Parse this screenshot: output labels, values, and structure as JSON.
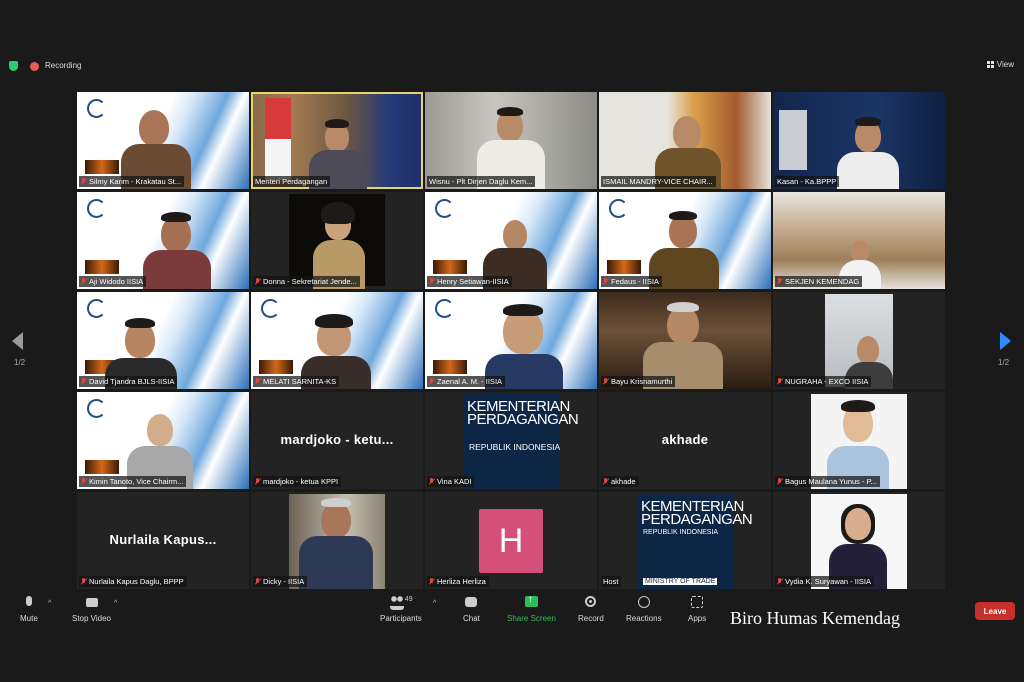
{
  "top": {
    "recording_label": "Recording",
    "view_label": "View"
  },
  "pagination": {
    "left": "1/2",
    "right": "1/2"
  },
  "tiles": [
    {
      "name": "Silmy Karim - Krakatau St..."
    },
    {
      "name": "Menteri Perdagangan"
    },
    {
      "name": "Wisnu - Plt Dirjen Daglu Kem..."
    },
    {
      "name": "ISMAIL MANDRY-VICE CHAIR..."
    },
    {
      "name": "Kasan - Ka.BPPP"
    },
    {
      "name": "Aji Widodo IISIA"
    },
    {
      "name": "Donna - Sekretariat Jende..."
    },
    {
      "name": "Henry Setiawan-IISIA"
    },
    {
      "name": "Fedaus - IISIA"
    },
    {
      "name": "SEKJEN KEMENDAG"
    },
    {
      "name": "David Tjandra BJLS-IISIA"
    },
    {
      "name": "MELATI SARNITA-KS"
    },
    {
      "name": "Zaenal A. M. - IISIA"
    },
    {
      "name": "Bayu Krisnamurthi"
    },
    {
      "name": "NUGRAHA - EXCO IISIA"
    },
    {
      "name": "Kimin Tanoto, Vice Chairm..."
    },
    {
      "name": "mardjoko - ketua KPPI",
      "center": "mardjoko - ketu..."
    },
    {
      "name": "Vina KADI",
      "slide_title": "KEMENTERIAN PERDAGANGAN",
      "slide_sub": "REPUBLIK INDONESIA"
    },
    {
      "name": "akhade",
      "center": "akhade"
    },
    {
      "name": "Bagus Maulana Yunus - P..."
    },
    {
      "name": "Nurlaila Kapus Daglu, BPPP",
      "center": "Nurlaila Kapus..."
    },
    {
      "name": "Dicky - IISIA"
    },
    {
      "name": "Herliza Herliza",
      "avatar": "H"
    },
    {
      "name": "Host",
      "slide_title": "KEMENTERIAN PERDAGANGAN",
      "slide_sub": "REPUBLIK INDONESIA",
      "slide_footer": "MINISTRY OF TRADE"
    },
    {
      "name": "Vydia K. Suryawan - IISIA"
    }
  ],
  "toolbar": {
    "mute": "Mute",
    "stop_video": "Stop Video",
    "participants": "Participants",
    "participants_count": "49",
    "chat": "Chat",
    "share_screen": "Share Screen",
    "record": "Record",
    "reactions": "Reactions",
    "apps": "Apps",
    "leave": "Leave"
  },
  "watermark": "Biro Humas Kemendag"
}
